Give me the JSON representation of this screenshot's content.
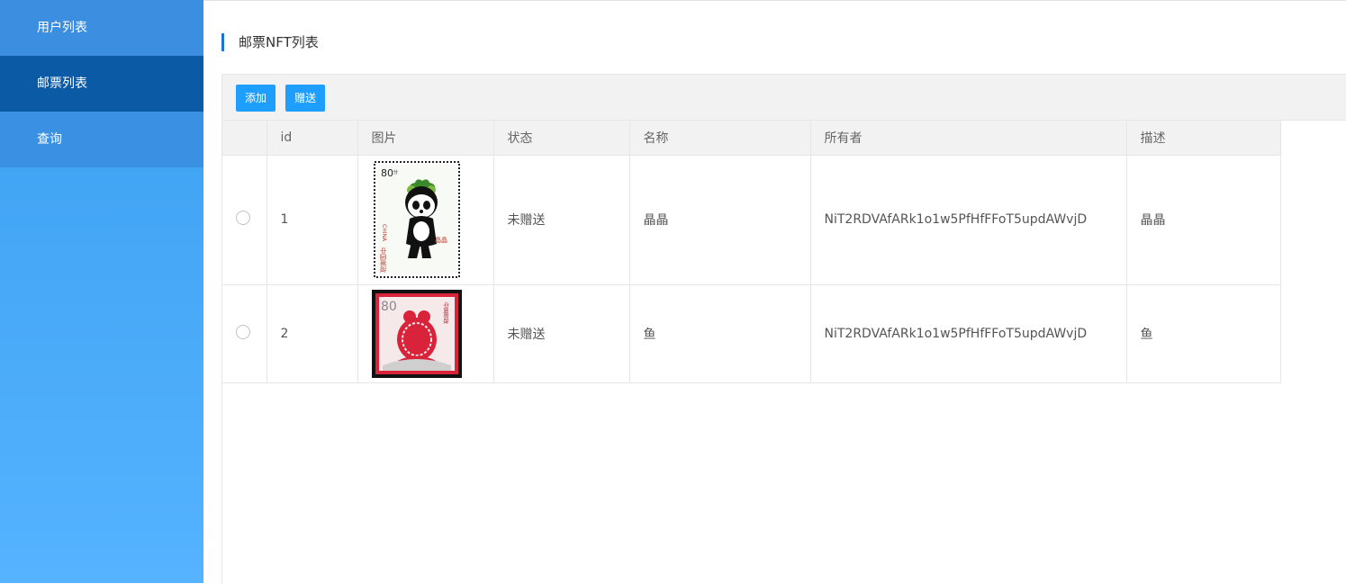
{
  "sidebar": {
    "items": [
      {
        "label": "用户列表",
        "active": false
      },
      {
        "label": "邮票列表",
        "active": true
      },
      {
        "label": "查询",
        "active": false
      }
    ]
  },
  "page": {
    "title": "邮票NFT列表"
  },
  "toolbar": {
    "add_label": "添加",
    "gift_label": "赠送"
  },
  "table": {
    "headers": [
      "id",
      "图片",
      "状态",
      "名称",
      "所有者",
      "描述"
    ],
    "rows": [
      {
        "id": "1",
        "status": "未赠送",
        "name": "晶晶",
        "owner": "NiT2RDVAfARk1o1w5PfHfFFoT5updAWvjD",
        "desc": "晶晶",
        "stamp": {
          "value": "80",
          "unit": "分",
          "country": "CHINA",
          "post": "中国邮政",
          "caption": "晶晶"
        }
      },
      {
        "id": "2",
        "status": "未赠送",
        "name": "鱼",
        "owner": "NiT2RDVAfARk1o1w5PfHfFFoT5updAWvjD",
        "desc": "鱼",
        "stamp": {
          "value": "80",
          "post": "中国邮政"
        }
      }
    ]
  },
  "colors": {
    "accent": "#1e9fff",
    "sidebar_active": "#0a5aa6",
    "title_bar": "#1a73d6"
  }
}
